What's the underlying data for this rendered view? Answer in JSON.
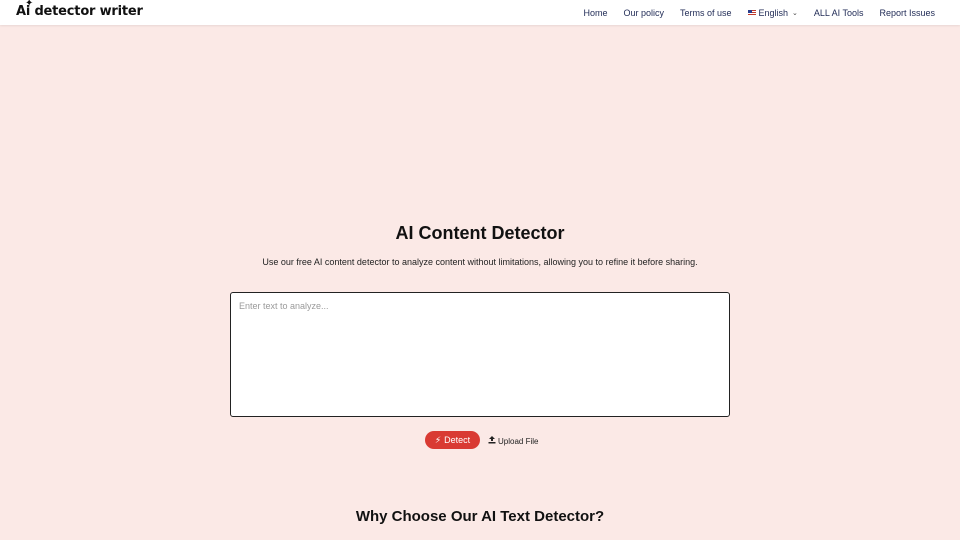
{
  "header": {
    "logo_text": "Ai detector writer",
    "logo_sparkle": "✦",
    "nav": {
      "home": "Home",
      "policy": "Our policy",
      "terms": "Terms of use",
      "language": "English",
      "tools": "ALL AI Tools",
      "report": "Report Issues"
    }
  },
  "main": {
    "title": "AI Content Detector",
    "subtitle": "Use our free AI content detector to analyze content without limitations, allowing you to refine it before sharing.",
    "textarea_placeholder": "Enter text to analyze...",
    "detect_label": "Detect",
    "upload_label": "Upload File",
    "section_title": "Why Choose Our AI Text Detector?"
  },
  "icons": {
    "detect": "bolt-icon",
    "upload": "upload-icon",
    "language": "us-flag-icon",
    "dropdown": "chevron-down-icon"
  },
  "colors": {
    "background": "#fbe9e6",
    "accent": "#d93a33",
    "nav_text": "#1f2a55"
  }
}
